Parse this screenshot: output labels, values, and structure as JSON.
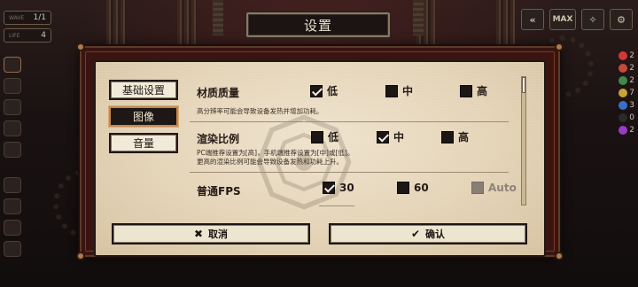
{
  "hud": {
    "wave_label": "WAVE",
    "wave_value": "1/1",
    "life_label": "LIFE",
    "life_value": "4",
    "right_counts": [
      "2",
      "2",
      "2",
      "7",
      "3",
      "0",
      "2"
    ],
    "right_colors": [
      "#d2383a",
      "#c54a3a",
      "#3f8a4a",
      "#c9a43a",
      "#3a6fc9",
      "#2a2a2a",
      "#9a3ac9"
    ]
  },
  "top_buttons": {
    "rewind_icon": "double-left-arrow",
    "max_label": "MAX",
    "gear_label": "⚙"
  },
  "dialog": {
    "title": "设置",
    "tabs": [
      {
        "label": "基础设置",
        "active": false
      },
      {
        "label": "图像",
        "active": true
      },
      {
        "label": "音量",
        "active": false
      }
    ],
    "settings": {
      "material": {
        "label": "材质质量",
        "options": [
          {
            "label": "低",
            "checked": true
          },
          {
            "label": "中",
            "checked": false
          },
          {
            "label": "高",
            "checked": false
          }
        ],
        "hint": "高分辨率可能会导致设备发热并增加功耗。"
      },
      "render": {
        "label": "渲染比例",
        "options": [
          {
            "label": "低",
            "checked": false
          },
          {
            "label": "中",
            "checked": true
          },
          {
            "label": "高",
            "checked": false
          }
        ],
        "hint_line1": "PC端推荐设置为[高]，手机端推荐设置为[中]或[低]。",
        "hint_line2": "更高的渲染比例可能会导致设备发热和功耗上升。"
      },
      "fps": {
        "label": "普通FPS",
        "options": [
          {
            "label": "30",
            "checked": true,
            "disabled": false
          },
          {
            "label": "60",
            "checked": false,
            "disabled": false
          },
          {
            "label": "Auto",
            "checked": false,
            "disabled": true
          }
        ]
      }
    },
    "buttons": {
      "cancel_label": "取消",
      "cancel_icon": "✖",
      "confirm_label": "确认",
      "confirm_icon": "✔"
    }
  }
}
